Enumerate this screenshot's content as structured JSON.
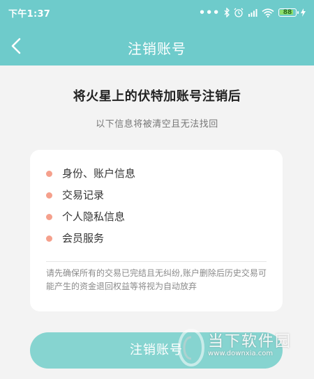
{
  "status_bar": {
    "time": "下午1:37",
    "battery_level": "88"
  },
  "nav": {
    "title": "注销账号"
  },
  "main": {
    "title": "将火星上的伏特加账号注销后",
    "subtitle": "以下信息将被清空且无法找回"
  },
  "card": {
    "items": [
      {
        "label": "身份、账户信息"
      },
      {
        "label": "交易记录"
      },
      {
        "label": "个人隐私信息"
      },
      {
        "label": "会员服务"
      }
    ],
    "note": "请先确保所有的交易已完结且无纠纷,账户删除后历史交易可能产生的资金退回权益等将视为自动放弃"
  },
  "action": {
    "submit_label": "注销账号"
  },
  "watermark": {
    "name": "当下软件园",
    "url": "www.downxia.com"
  },
  "colors": {
    "header": "#6ecbcb",
    "bullet": "#f5a08c",
    "button": "#86d4d0",
    "background": "#f3f3f3"
  }
}
